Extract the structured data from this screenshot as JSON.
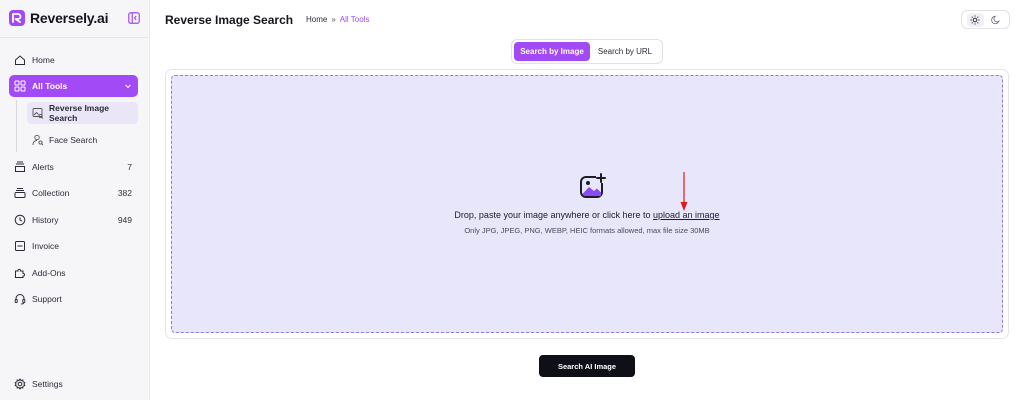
{
  "brand": {
    "name": "Reversely.ai",
    "accent": "#a24af5"
  },
  "sidebar": {
    "items": [
      {
        "label": "Home",
        "icon": "home-icon"
      },
      {
        "label": "All Tools",
        "icon": "grid-icon",
        "active": true
      },
      {
        "label": "Alerts",
        "icon": "bell-icon",
        "count": "7"
      },
      {
        "label": "Collection",
        "icon": "layers-icon",
        "count": "382"
      },
      {
        "label": "History",
        "icon": "clock-icon",
        "count": "949"
      },
      {
        "label": "Invoice",
        "icon": "invoice-icon"
      },
      {
        "label": "Add-Ons",
        "icon": "puzzle-icon"
      },
      {
        "label": "Support",
        "icon": "support-icon"
      },
      {
        "label": "Settings",
        "icon": "gear-icon"
      }
    ],
    "subitems": [
      {
        "label": "Reverse Image Search",
        "icon": "image-search-icon",
        "selected": true
      },
      {
        "label": "Face Search",
        "icon": "face-search-icon"
      }
    ]
  },
  "header": {
    "title": "Reverse Image Search",
    "breadcrumb": {
      "home": "Home",
      "separator": "»",
      "current": "All Tools"
    }
  },
  "tabs": [
    {
      "label": "Search by Image",
      "active": true
    },
    {
      "label": "Search by URL"
    }
  ],
  "upload": {
    "prompt_prefix": "Drop, paste your image anywhere or click here to ",
    "prompt_link": "upload an image",
    "formats": "Only JPG, JPEG, PNG, WEBP, HEIC formats allowed, max file size 30MB"
  },
  "search_button": "Search AI Image",
  "colors": {
    "primary": "#a24af5",
    "dropzone": "#e8e6fb",
    "button": "#0f0f17",
    "annotation_arrow": "#e0191b"
  }
}
